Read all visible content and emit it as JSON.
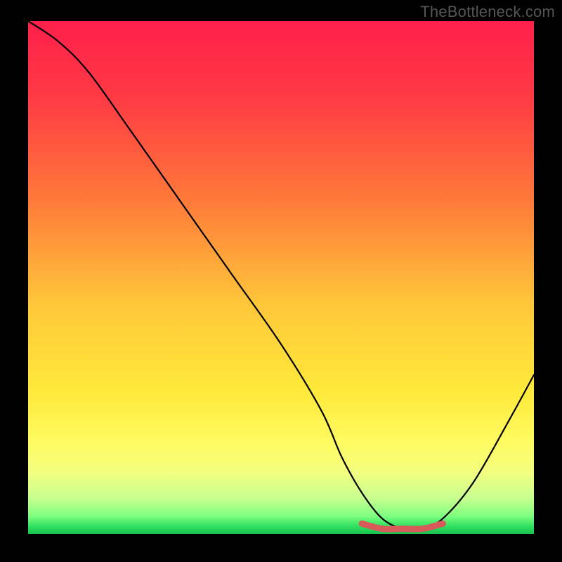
{
  "watermark": "TheBottleneck.com",
  "chart_data": {
    "type": "line",
    "title": "",
    "xlabel": "",
    "ylabel": "",
    "xlim": [
      0,
      100
    ],
    "ylim": [
      0,
      100
    ],
    "series": [
      {
        "name": "bottleneck-curve",
        "x": [
          0,
          6,
          12,
          20,
          30,
          40,
          50,
          58,
          62,
          66,
          70,
          74,
          78,
          82,
          88,
          95,
          100
        ],
        "values": [
          100,
          96,
          90,
          79,
          65,
          51,
          37,
          24,
          15,
          8,
          3,
          1,
          1,
          3,
          10,
          22,
          31
        ]
      },
      {
        "name": "optimal-range-marker",
        "x": [
          66,
          70,
          74,
          78,
          82
        ],
        "values": [
          2,
          1,
          1,
          1,
          2
        ]
      }
    ],
    "gradient_stops": [
      {
        "pos": 0.0,
        "color": "#ff1f4b"
      },
      {
        "pos": 0.15,
        "color": "#ff3a44"
      },
      {
        "pos": 0.35,
        "color": "#ff7a3a"
      },
      {
        "pos": 0.55,
        "color": "#ffc63a"
      },
      {
        "pos": 0.72,
        "color": "#ffe93a"
      },
      {
        "pos": 0.82,
        "color": "#fffb60"
      },
      {
        "pos": 0.88,
        "color": "#f3ff80"
      },
      {
        "pos": 0.93,
        "color": "#c8ff90"
      },
      {
        "pos": 0.965,
        "color": "#80ff80"
      },
      {
        "pos": 0.985,
        "color": "#30e060"
      },
      {
        "pos": 1.0,
        "color": "#16c24e"
      }
    ],
    "marker_color": "#d85a5a"
  }
}
